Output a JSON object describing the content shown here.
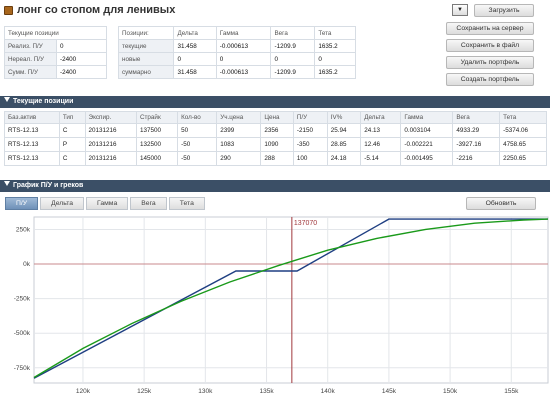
{
  "app": {
    "title": "лонг со стопом для ленивых"
  },
  "pnl_table": {
    "header": "Текущие позиции",
    "rows": [
      {
        "label": "Реализ. П/У",
        "value": "0"
      },
      {
        "label": "Нереал. П/У",
        "value": "-2400"
      },
      {
        "label": "Сумм. П/У",
        "value": "-2400"
      }
    ]
  },
  "greeks_table": {
    "columns": [
      "Позиции:",
      "Дельта",
      "Гамма",
      "Вега",
      "Тета"
    ],
    "rows": [
      [
        "текущие",
        "31.458",
        "-0.000613",
        "-1209.9",
        "1635.2"
      ],
      [
        "новые",
        "0",
        "0",
        "0",
        "0"
      ],
      [
        "суммарно",
        "31.458",
        "-0.000613",
        "-1209.9",
        "1635.2"
      ]
    ]
  },
  "toolbar": {
    "select_glyph": "▼",
    "load": "Загрузить",
    "save_server": "Сохранить на сервер",
    "save_file": "Сохранить в файл",
    "delete": "Удалить портфель",
    "create": "Создать портфель"
  },
  "positions_section": {
    "title": "Текущие позиции",
    "columns": [
      "Баз.актив",
      "Тип",
      "Экспир.",
      "Страйк",
      "Кол-во",
      "Уч.цена",
      "Цена",
      "П/У",
      "IV%",
      "Дельта",
      "Гамма",
      "Вега",
      "Тета"
    ],
    "rows": [
      [
        "RTS-12.13",
        "C",
        "20131216",
        "137500",
        "50",
        "2399",
        "2356",
        "-2150",
        "25.94",
        "24.13",
        "0.003104",
        "4933.29",
        "-5374.06"
      ],
      [
        "RTS-12.13",
        "P",
        "20131216",
        "132500",
        "-50",
        "1083",
        "1090",
        "-350",
        "28.85",
        "12.46",
        "-0.002221",
        "-3927.16",
        "4758.65"
      ],
      [
        "RTS-12.13",
        "C",
        "20131216",
        "145000",
        "-50",
        "290",
        "288",
        "100",
        "24.18",
        "-5.14",
        "-0.001495",
        "-2216",
        "2250.65"
      ]
    ]
  },
  "chart_section": {
    "title": "График П/У и греков",
    "tabs": [
      "П/У",
      "Дельта",
      "Гамма",
      "Вега",
      "Тета"
    ],
    "active_tab": "П/У",
    "refresh": "Обновить"
  },
  "colors": {
    "section_bar": "#3b4f66",
    "expiry_line": "#1f3f82",
    "current_line": "#1a9a1a",
    "marker": "#a0383c"
  },
  "chart_data": {
    "type": "line",
    "xlim": [
      116000,
      158000
    ],
    "ylim": [
      -860000,
      340000
    ],
    "x_ticks": [
      120000,
      125000,
      130000,
      135000,
      140000,
      145000,
      150000,
      155000
    ],
    "x_tick_labels": [
      "120k",
      "125k",
      "130k",
      "135k",
      "140k",
      "145k",
      "150k",
      "155k"
    ],
    "y_ticks": [
      250000,
      0,
      -250000,
      -500000,
      -750000
    ],
    "y_tick_labels": [
      "250k",
      "0k",
      "-250k",
      "-500k",
      "-750k"
    ],
    "marker": {
      "x": 137070,
      "label": "137070"
    },
    "series": [
      {
        "x": [
          116000,
          132500,
          137500,
          145000,
          158000
        ],
        "y": [
          -825000,
          -50000,
          -50000,
          325000,
          325000
        ],
        "color": "#1f3f82"
      },
      {
        "x": [
          116000,
          120000,
          124000,
          128000,
          132000,
          136000,
          140000,
          144000,
          148000,
          152000,
          156000,
          158000
        ],
        "y": [
          -820000,
          -610000,
          -430000,
          -270000,
          -130000,
          -10000,
          100000,
          185000,
          250000,
          295000,
          318000,
          325000
        ],
        "color": "#1a9a1a"
      }
    ]
  }
}
